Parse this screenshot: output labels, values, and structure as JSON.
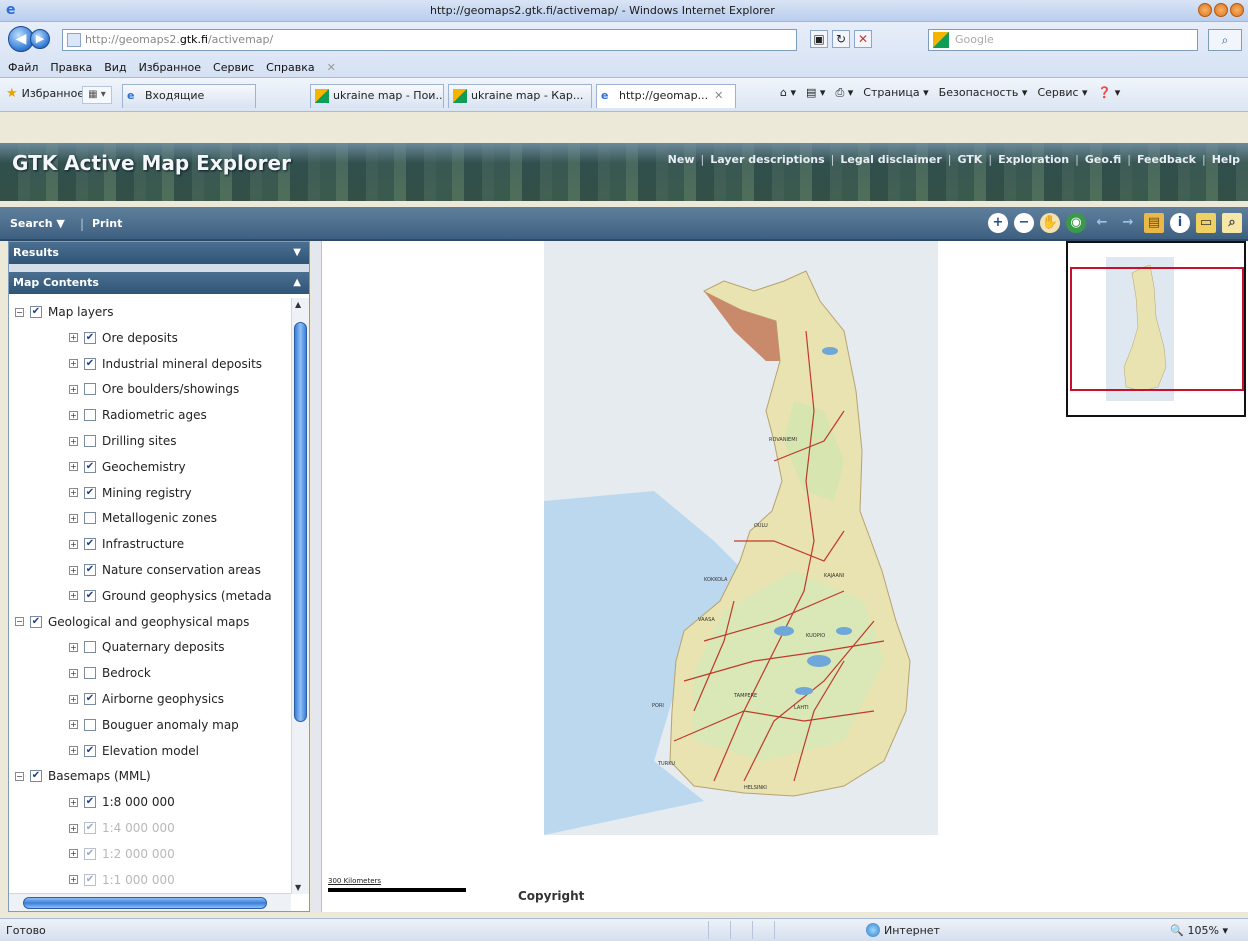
{
  "browser": {
    "window_title": "http://geomaps2.gtk.fi/activemap/ - Windows Internet Explorer",
    "url_prefix": "http://geomaps2.",
    "url_host": "gtk.fi",
    "url_suffix": "/activemap/",
    "search_placeholder": "Google",
    "menu": [
      "Файл",
      "Правка",
      "Вид",
      "Избранное",
      "Сервис",
      "Справка"
    ],
    "favorites_label": "Избранное",
    "inbox_label": "Входящие",
    "tabs": [
      {
        "label": "ukraine map - Пои..."
      },
      {
        "label": "ukraine map - Кар..."
      },
      {
        "label": "http://geomap..."
      }
    ],
    "command_bar": [
      "Страница ▾",
      "Безопасность ▾",
      "Сервис ▾"
    ],
    "status_text": "Готово",
    "zone_label": "Интернет",
    "zoom_label": "105%"
  },
  "app": {
    "title": "GTK Active Map Explorer",
    "nav": [
      "New",
      "Layer descriptions",
      "Legal disclaimer",
      "GTK",
      "Exploration",
      "Geo.fi",
      "Feedback",
      "Help"
    ],
    "toolbar": {
      "search_label": "Search ▼",
      "separator": "|",
      "print_label": "Print"
    }
  },
  "panel": {
    "results_label": "Results",
    "contents_label": "Map Contents",
    "tree": [
      {
        "label": "Map layers",
        "level": 0,
        "checked": true,
        "disabled": false
      },
      {
        "label": "Ore deposits",
        "level": 1,
        "checked": true,
        "disabled": false
      },
      {
        "label": "Industrial mineral deposits",
        "level": 1,
        "checked": true,
        "disabled": false
      },
      {
        "label": "Ore boulders/showings",
        "level": 1,
        "checked": false,
        "disabled": false
      },
      {
        "label": "Radiometric ages",
        "level": 1,
        "checked": false,
        "disabled": false
      },
      {
        "label": "Drilling sites",
        "level": 1,
        "checked": false,
        "disabled": false
      },
      {
        "label": "Geochemistry",
        "level": 1,
        "checked": true,
        "disabled": false
      },
      {
        "label": "Mining registry",
        "level": 1,
        "checked": true,
        "disabled": false
      },
      {
        "label": "Metallogenic zones",
        "level": 1,
        "checked": false,
        "disabled": false
      },
      {
        "label": "Infrastructure",
        "level": 1,
        "checked": true,
        "disabled": false
      },
      {
        "label": "Nature conservation areas",
        "level": 1,
        "checked": true,
        "disabled": false
      },
      {
        "label": "Ground geophysics (metada",
        "level": 1,
        "checked": true,
        "disabled": false
      },
      {
        "label": "Geological and geophysical maps",
        "level": 0,
        "checked": true,
        "disabled": false
      },
      {
        "label": "Quaternary deposits",
        "level": 1,
        "checked": false,
        "disabled": false
      },
      {
        "label": "Bedrock",
        "level": 1,
        "checked": false,
        "disabled": false
      },
      {
        "label": "Airborne geophysics",
        "level": 1,
        "checked": true,
        "disabled": false
      },
      {
        "label": "Bouguer anomaly map",
        "level": 1,
        "checked": false,
        "disabled": false
      },
      {
        "label": "Elevation model",
        "level": 1,
        "checked": true,
        "disabled": false
      },
      {
        "label": "Basemaps (MML)",
        "level": 0,
        "checked": true,
        "disabled": false
      },
      {
        "label": "1:8 000 000",
        "level": 1,
        "checked": true,
        "disabled": false
      },
      {
        "label": "1:4 000 000",
        "level": 1,
        "checked": true,
        "disabled": true
      },
      {
        "label": "1:2 000 000",
        "level": 1,
        "checked": true,
        "disabled": true
      },
      {
        "label": "1:1 000 000",
        "level": 1,
        "checked": true,
        "disabled": true
      }
    ]
  },
  "map": {
    "scale_label": "300 Kilometers",
    "copyright_label": "Copyright"
  },
  "colors": {
    "header_bar": "#3e6080",
    "overview_frame": "#c8102e",
    "land": "#e8e3b0",
    "sea": "#bcd8ee",
    "roads": "#c0392b"
  }
}
